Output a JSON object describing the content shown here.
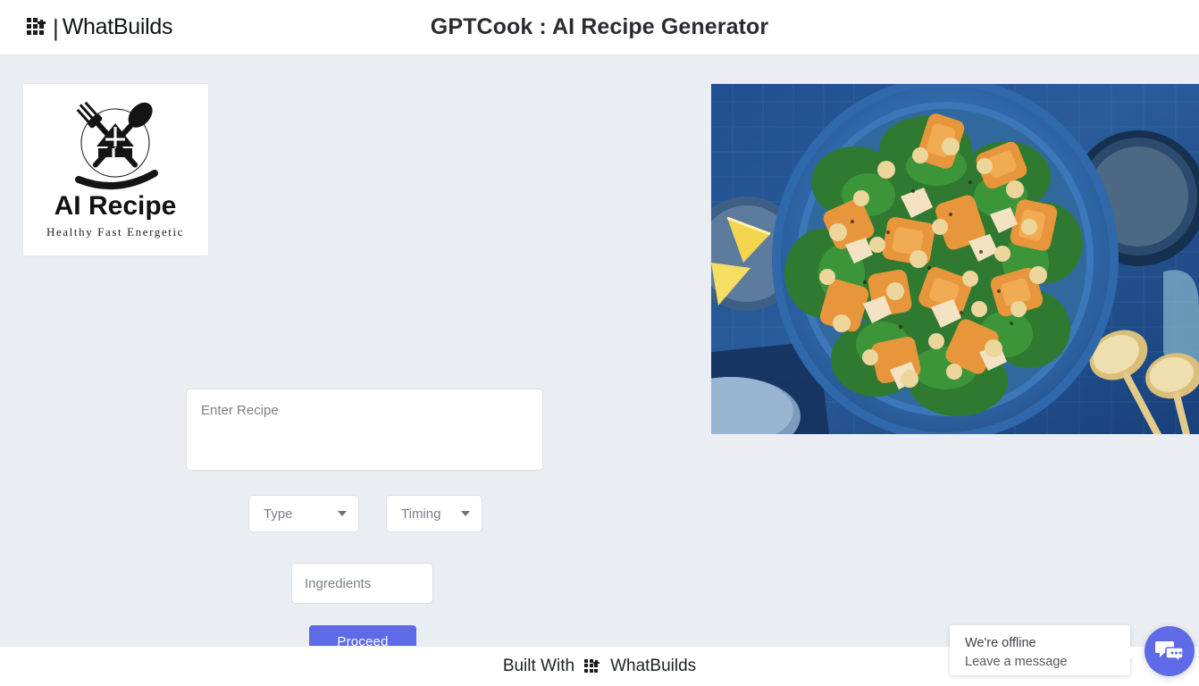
{
  "header": {
    "brand_icon": "grid-dots-logo",
    "brand_separator": "|",
    "brand_name": "WhatBuilds",
    "app_title": "GPTCook : AI Recipe Generator"
  },
  "main": {
    "logo_card": {
      "icon": "fork-spoon-crossed-logo",
      "title": "AI Recipe",
      "tagline": "Healthy Fast Energetic"
    },
    "hero_photo": {
      "alt": "roasted-pumpkin-kale-chickpea-salad-photo"
    },
    "form": {
      "recipe_placeholder": "Enter Recipe",
      "recipe_value": "",
      "type_select": {
        "label": "Type",
        "value": "",
        "caret_icon": "chevron-down-icon"
      },
      "timing_select": {
        "label": "Timing",
        "value": "",
        "caret_icon": "chevron-down-icon"
      },
      "ingredients_placeholder": "Ingredients",
      "ingredients_value": "",
      "proceed_label": "Proceed",
      "proceed_color": "#5e6ae6"
    }
  },
  "footer": {
    "built_with": "Built With",
    "brand_icon": "grid-dots-logo",
    "brand_name": "WhatBuilds"
  },
  "chat_widget": {
    "status_line": "We're offline",
    "action_line": "Leave a message",
    "button_icon": "chat-bubbles-icon",
    "button_color": "#5e6ae6"
  },
  "colors": {
    "page_background": "#eaeef3",
    "header_background": "#ffffff",
    "footer_background": "#ffffff",
    "accent": "#5e6ae6",
    "text_primary": "#2b2b33",
    "text_muted": "#7b7f86"
  }
}
